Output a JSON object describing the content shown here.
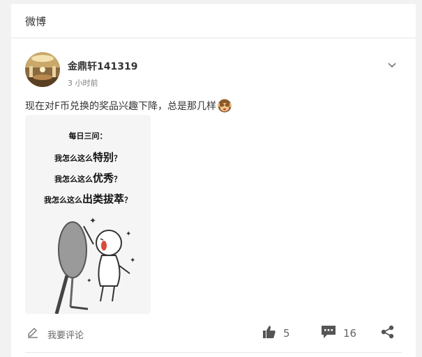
{
  "app": {
    "title": "微博"
  },
  "post": {
    "author": "金鼎轩141319",
    "time": "3 小时前",
    "text": "现在对F币兑换的奖品兴趣下降，总是那几样",
    "image": {
      "line1": "每日三问：",
      "line2_prefix": "我怎么这么",
      "line2_em": "特别",
      "line2_suffix": "？",
      "line3_prefix": "我怎么这么",
      "line3_em": "优秀",
      "line3_suffix": "？",
      "line4_prefix": "我怎么这么",
      "line4_em": "出类拔萃",
      "line4_suffix": "？"
    }
  },
  "footer": {
    "comment_placeholder": "我要评论",
    "likes": "5",
    "comments": "16"
  },
  "icons": {
    "edit": "pencil-icon",
    "like": "thumb-up-icon",
    "comment": "comment-bubble-icon",
    "share": "share-icon",
    "more": "chevron-down-icon",
    "emoji": "monkey-see-no-evil-icon"
  }
}
